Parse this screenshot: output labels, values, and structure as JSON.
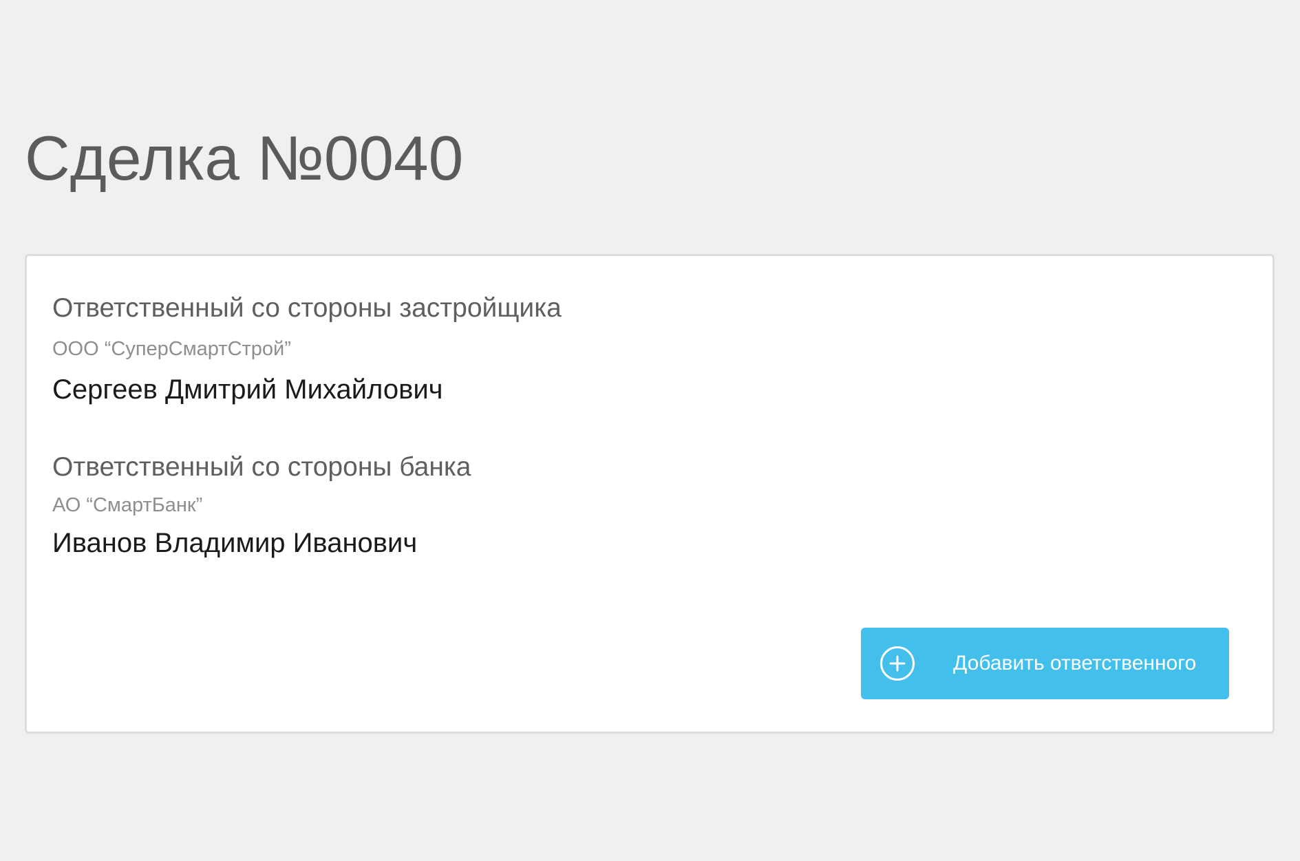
{
  "page": {
    "title": "Сделка №0040"
  },
  "developer_section": {
    "heading": "Ответственный со стороны застройщика",
    "organization": "ООО “СуперСмартСтрой”",
    "person": "Сергеев Дмитрий Михайлович"
  },
  "bank_section": {
    "heading": "Ответственный со стороны банка",
    "organization": "АО “СмартБанк”",
    "person": "Иванов Владимир Иванович"
  },
  "actions": {
    "add_responsible_label": "Добавить ответственного",
    "add_responsible_icon": "plus-circle-icon"
  },
  "colors": {
    "background": "#f0f0f0",
    "card": "#ffffff",
    "accent": "#42bfeb",
    "title_text": "#5b5b5b",
    "muted_text": "#8e8e8e",
    "primary_text": "#1a1a1a"
  }
}
